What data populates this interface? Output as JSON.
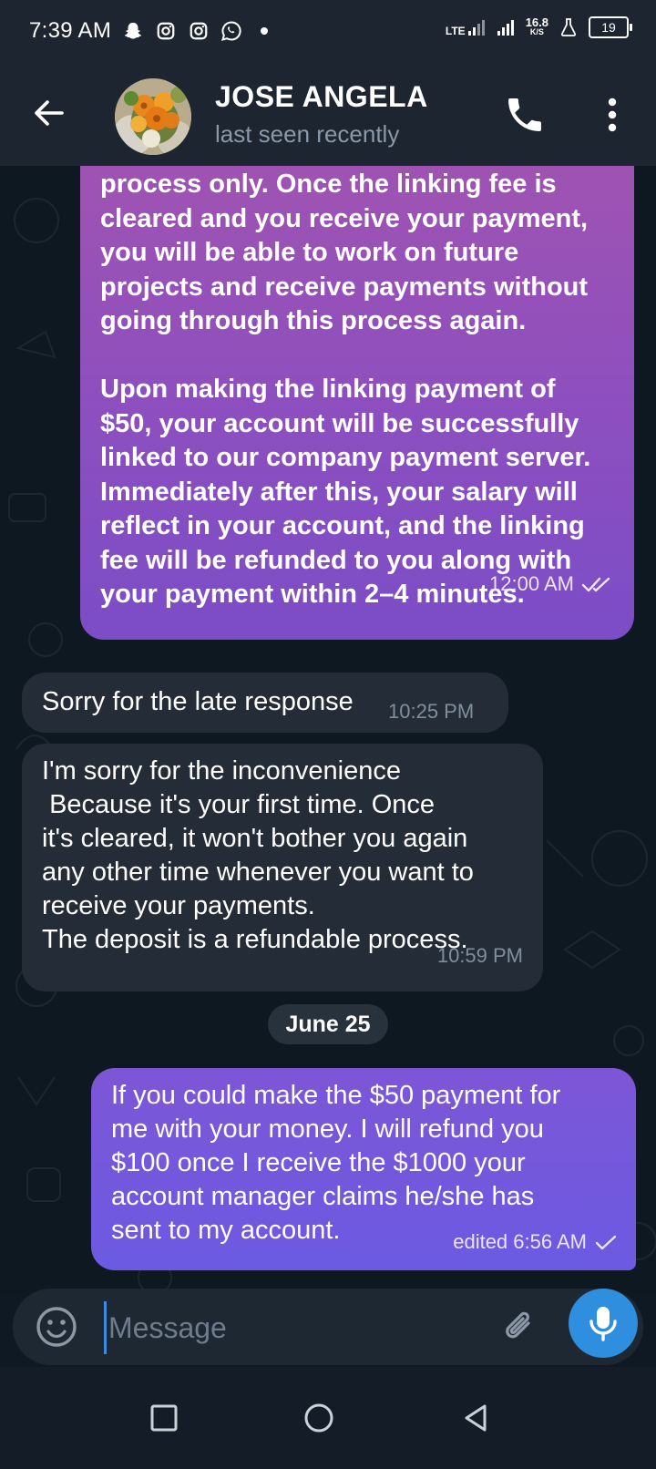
{
  "status_bar": {
    "time": "7:39 AM",
    "network": "LTE",
    "speed_value": "16.8",
    "speed_unit": "K/S",
    "battery": "19"
  },
  "header": {
    "contact_name": "JOSE ANGELA",
    "contact_status": "last seen recently"
  },
  "messages": [
    {
      "direction": "out",
      "text": "process only. Once the linking fee is\ncleared and you receive your payment,\nyou will be able to work on future\nprojects and receive payments without\ngoing through this process again.\n\nUpon making the linking payment of\n$50, your account will be successfully\nlinked to our company payment server.\nImmediately after this, your salary will\nreflect in your account, and the linking\nfee will be refunded to you along with\nyour payment within 2–4 minutes.",
      "time": "12:00 AM",
      "status": "read"
    },
    {
      "direction": "in",
      "text": "Sorry for the late response",
      "time": "10:25 PM"
    },
    {
      "direction": "in",
      "text": "I'm sorry for the inconvenience\n Because it's your first time. Once\nit's cleared, it won't bother you again\nany other time whenever you want to\nreceive your payments.\nThe deposit is a refundable process.",
      "time": "10:59 PM"
    },
    {
      "direction": "out",
      "text": "If you could make the $50 payment for\nme with your money. I will refund you\n$100 once I receive the $1000 your\naccount manager claims he/she has\nsent to my account.",
      "time": "edited 6:56 AM",
      "status": "sent"
    }
  ],
  "date_separator": "June 25",
  "composer": {
    "placeholder": "Message"
  },
  "colors": {
    "header_bg": "#1c2530",
    "chat_bg": "#0e1821",
    "incoming_bubble": "#242d37",
    "outgoing_bubble_top": "#a154b0",
    "outgoing_bubble_bottom": "#6b5ae2",
    "mic_button": "#2f8ede"
  }
}
